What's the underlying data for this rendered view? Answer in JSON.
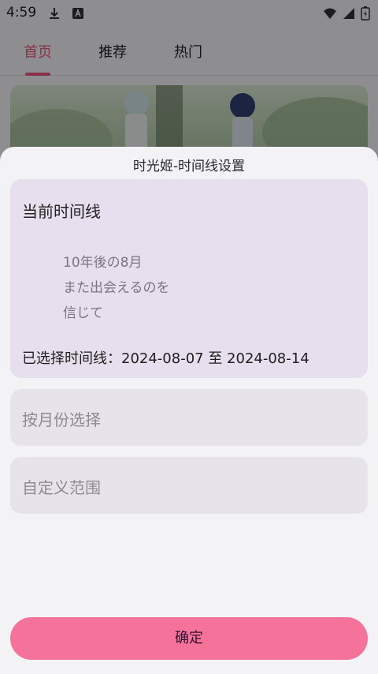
{
  "status_bar": {
    "time": "4:59",
    "icons": [
      "download-icon",
      "a-badge-icon",
      "wifi-icon",
      "cellular-signal-icon",
      "battery-icon"
    ]
  },
  "tabs": [
    {
      "label": "首页",
      "active": true
    },
    {
      "label": "推荐",
      "active": false
    },
    {
      "label": "热门",
      "active": false
    }
  ],
  "colors": {
    "accent": "#e8577d",
    "confirm_button": "#f5729b",
    "current_card": "#e7dfed",
    "option_card": "#e7e3ea",
    "sheet": "#f3f2f5"
  },
  "sheet": {
    "title": "时光姬-时间线设置",
    "current": {
      "heading": "当前时间线",
      "quote_lines": [
        "10年後の8月",
        "また出会えるのを",
        "信じて"
      ],
      "selected_range": "已选择时间线：2024-08-07 至 2024-08-14"
    },
    "options": {
      "by_month": "按月份选择",
      "custom_range": "自定义范围"
    },
    "confirm_label": "确定"
  }
}
